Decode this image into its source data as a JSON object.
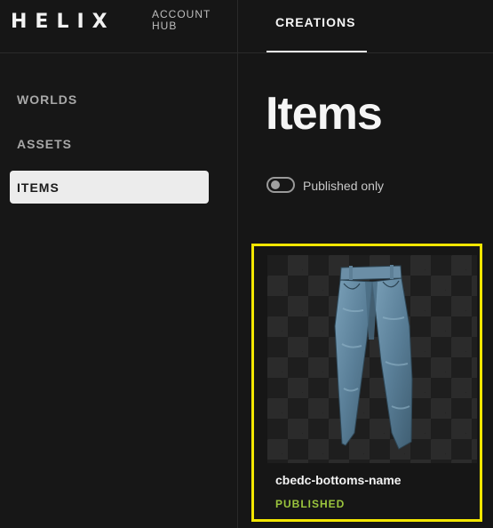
{
  "brand": {
    "logo": "HELIX",
    "hub_line1": "ACCOUNT",
    "hub_line2": "HUB"
  },
  "header": {
    "tabs": [
      {
        "label": "CREATIONS",
        "active": true
      }
    ]
  },
  "sidebar": {
    "items": [
      {
        "label": "WORLDS",
        "active": false
      },
      {
        "label": "ASSETS",
        "active": false
      },
      {
        "label": "ITEMS",
        "active": true
      }
    ]
  },
  "main": {
    "title": "Items",
    "filter": {
      "label": "Published only",
      "enabled": false
    },
    "items": [
      {
        "name": "cbedc-bottoms-name",
        "status": "PUBLISHED",
        "status_color": "#9bc53d",
        "thumbnail_icon": "jeans-icon",
        "selected": true
      }
    ]
  },
  "colors": {
    "accent_selection": "#f2e600",
    "published": "#9bc53d",
    "background": "#161616"
  }
}
